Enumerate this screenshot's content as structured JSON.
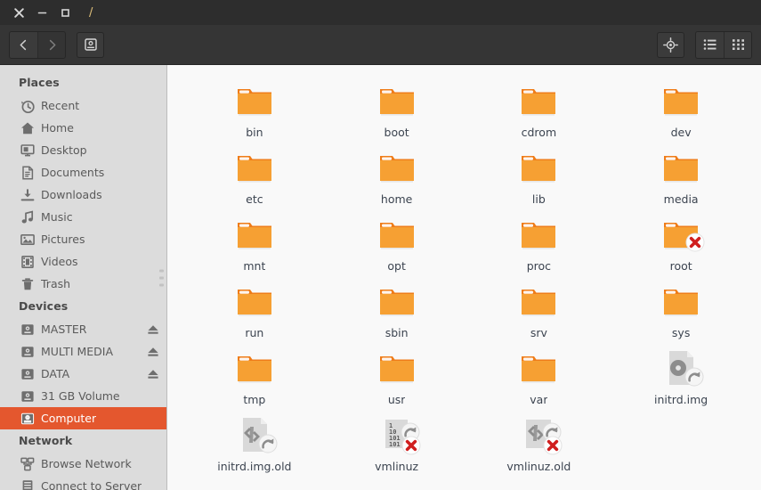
{
  "window": {
    "title": "/",
    "controls": {
      "close": "close",
      "minimize": "minimize",
      "maximize": "maximize"
    }
  },
  "toolbar": {
    "back_label": "Back",
    "forward_label": "Forward",
    "location_label": "Computer",
    "list_view_label": "List view",
    "grid_view_label": "Icon view"
  },
  "sidebar": {
    "sections": [
      {
        "title": "Places",
        "items": [
          {
            "label": "Recent",
            "icon": "clock-icon",
            "eject": false,
            "selected": false
          },
          {
            "label": "Home",
            "icon": "home-icon",
            "eject": false,
            "selected": false
          },
          {
            "label": "Desktop",
            "icon": "desktop-icon",
            "eject": false,
            "selected": false
          },
          {
            "label": "Documents",
            "icon": "document-icon",
            "eject": false,
            "selected": false
          },
          {
            "label": "Downloads",
            "icon": "download-icon",
            "eject": false,
            "selected": false
          },
          {
            "label": "Music",
            "icon": "music-note-icon",
            "eject": false,
            "selected": false
          },
          {
            "label": "Pictures",
            "icon": "picture-icon",
            "eject": false,
            "selected": false
          },
          {
            "label": "Videos",
            "icon": "film-icon",
            "eject": false,
            "selected": false
          },
          {
            "label": "Trash",
            "icon": "trash-icon",
            "eject": false,
            "selected": false
          }
        ]
      },
      {
        "title": "Devices",
        "items": [
          {
            "label": "MASTER",
            "icon": "drive-icon",
            "eject": true,
            "selected": false
          },
          {
            "label": "MULTI MEDIA",
            "icon": "drive-icon",
            "eject": true,
            "selected": false
          },
          {
            "label": "DATA",
            "icon": "drive-icon",
            "eject": true,
            "selected": false
          },
          {
            "label": "31 GB Volume",
            "icon": "drive-icon",
            "eject": false,
            "selected": false
          },
          {
            "label": "Computer",
            "icon": "drive-icon",
            "eject": false,
            "selected": true
          }
        ]
      },
      {
        "title": "Network",
        "items": [
          {
            "label": "Browse Network",
            "icon": "network-icon",
            "eject": false,
            "selected": false
          },
          {
            "label": "Connect to Server",
            "icon": "server-icon",
            "eject": false,
            "selected": false
          }
        ]
      }
    ]
  },
  "files": {
    "items": [
      {
        "name": "bin",
        "type": "folder",
        "emblems": []
      },
      {
        "name": "boot",
        "type": "folder",
        "emblems": []
      },
      {
        "name": "cdrom",
        "type": "folder",
        "emblems": []
      },
      {
        "name": "dev",
        "type": "folder",
        "emblems": []
      },
      {
        "name": "etc",
        "type": "folder",
        "emblems": []
      },
      {
        "name": "home",
        "type": "folder",
        "emblems": []
      },
      {
        "name": "lib",
        "type": "folder",
        "emblems": []
      },
      {
        "name": "media",
        "type": "folder",
        "emblems": []
      },
      {
        "name": "mnt",
        "type": "folder",
        "emblems": []
      },
      {
        "name": "opt",
        "type": "folder",
        "emblems": []
      },
      {
        "name": "proc",
        "type": "folder",
        "emblems": []
      },
      {
        "name": "root",
        "type": "folder",
        "emblems": [
          "unreadable"
        ]
      },
      {
        "name": "run",
        "type": "folder",
        "emblems": []
      },
      {
        "name": "sbin",
        "type": "folder",
        "emblems": []
      },
      {
        "name": "srv",
        "type": "folder",
        "emblems": []
      },
      {
        "name": "sys",
        "type": "folder",
        "emblems": []
      },
      {
        "name": "tmp",
        "type": "folder",
        "emblems": []
      },
      {
        "name": "usr",
        "type": "folder",
        "emblems": []
      },
      {
        "name": "var",
        "type": "folder",
        "emblems": []
      },
      {
        "name": "initrd.img",
        "type": "disc-file",
        "emblems": [
          "symlink"
        ]
      },
      {
        "name": "initrd.img.old",
        "type": "gear-file",
        "emblems": [
          "symlink"
        ]
      },
      {
        "name": "vmlinuz",
        "type": "binary-file",
        "emblems": [
          "symlink-high",
          "unreadable-low"
        ]
      },
      {
        "name": "vmlinuz.old",
        "type": "gear-plain",
        "emblems": [
          "symlink-high",
          "unreadable-low"
        ]
      }
    ]
  },
  "colors": {
    "titlebar": "#2d2d2d",
    "toolbar": "#353535",
    "sidebar": "#dcdcdc",
    "selection": "#e4572e",
    "folder": "#f6a033",
    "folder_tab": "#ef7d1a",
    "file_area": "#f9f9f9",
    "label_text": "#3c4450"
  }
}
